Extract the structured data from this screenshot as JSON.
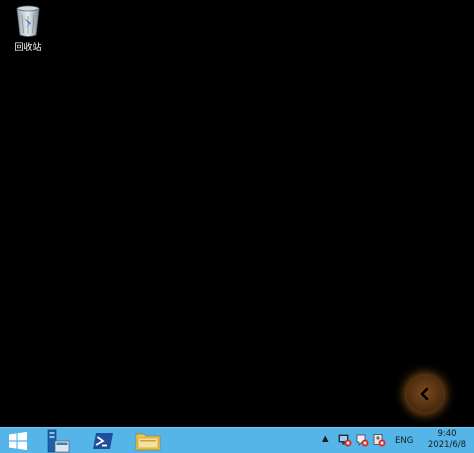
{
  "desktop": {
    "icons": [
      {
        "label": "回收站",
        "icon": "recycle-bin-icon"
      }
    ],
    "back_button_icon": "chevron-left-icon",
    "back_glow_color": "#a05f1e"
  },
  "taskbar": {
    "color": "#55b4e8",
    "start_icon": "windows-logo-icon",
    "apps": [
      {
        "icon": "server-manager-icon"
      },
      {
        "icon": "powershell-icon"
      },
      {
        "icon": "file-explorer-icon"
      }
    ],
    "tray": {
      "overflow_arrow": "▲",
      "icons": [
        "network-error-icon",
        "action-center-error-icon",
        "speaker-error-icon"
      ],
      "language": "ENG"
    },
    "clock": {
      "time": "9:40",
      "date": "2021/6/8"
    }
  }
}
